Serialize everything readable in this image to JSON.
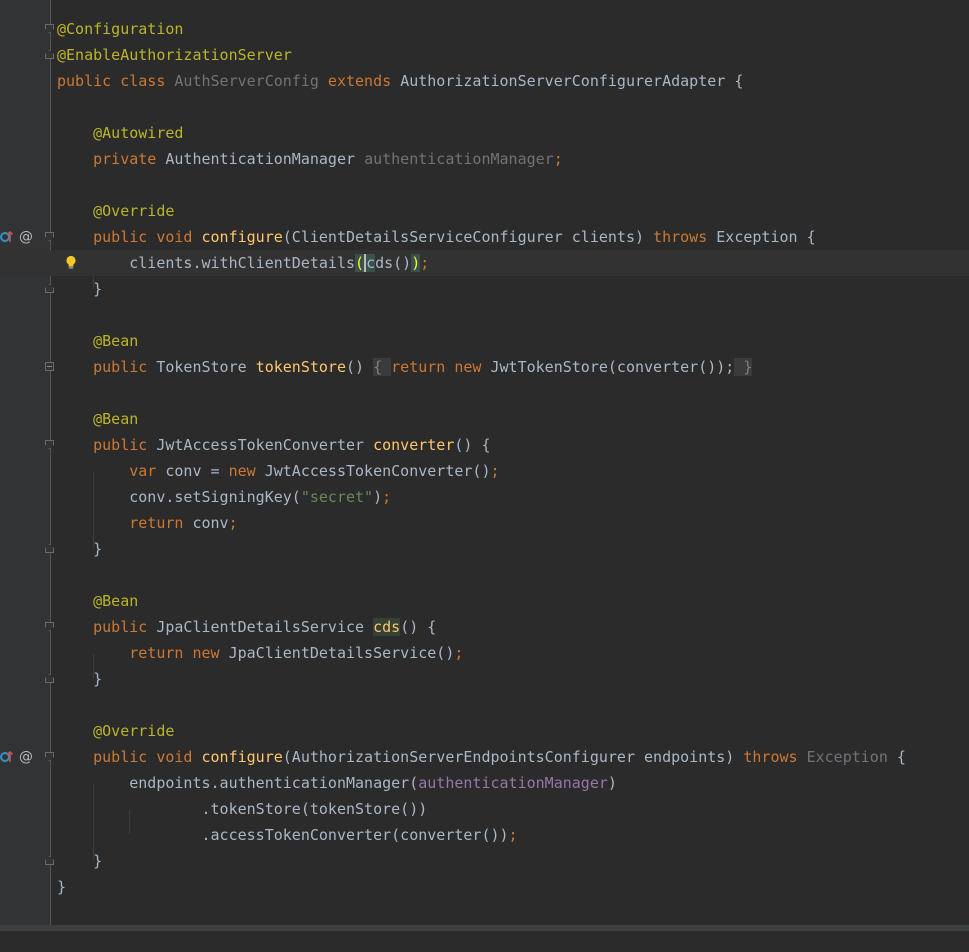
{
  "colors": {
    "background": "#2b2b2b",
    "gutter": "#313335",
    "keyword": "#cc7832",
    "annotation": "#bbb529",
    "method": "#ffc66d",
    "string": "#6a8759",
    "field": "#9876aa",
    "text": "#a9b7c6"
  },
  "code": {
    "l1": "@Configuration",
    "l2": "@EnableAuthorizationServer",
    "l3_public": "public class ",
    "l3_name": "AuthServerConfig",
    "l3_extends": " extends ",
    "l3_super": "AuthorizationServerConfigurerAdapter {",
    "l5": "@Autowired",
    "l6_private": "private ",
    "l6_type": "AuthenticationManager ",
    "l6_field": "authenticationManager",
    "l6_semi": ";",
    "l8": "@Override",
    "l9_kw": "public void ",
    "l9_fn": "configure",
    "l9_params": "(ClientDetailsServiceConfigurer clients) ",
    "l9_throws": "throws ",
    "l9_exc": "Exception {",
    "l10_a": "clients.withClientDetails",
    "l10_open": "(",
    "l10_c": "c",
    "l10_ds": "ds()",
    "l10_close": ")",
    "l10_semi": ";",
    "l11": "}",
    "l13": "@Bean",
    "l14_kw": "public ",
    "l14_type": "TokenStore ",
    "l14_fn": "tokenStore",
    "l14_paren": "() ",
    "l14_ob": "{ ",
    "l14_ret": "return new ",
    "l14_expr": "JwtTokenStore(converter());",
    "l14_cb": " }",
    "l16": "@Bean",
    "l17_kw": "public ",
    "l17_type": "JwtAccessTokenConverter ",
    "l17_fn": "converter",
    "l17_rest": "() {",
    "l18_var": "var ",
    "l18_mid": "conv = ",
    "l18_new": "new ",
    "l18_expr": "JwtAccessTokenConverter()",
    "l18_semi": ";",
    "l19_a": "conv.setSigningKey(",
    "l19_str": "\"secret\"",
    "l19_b": ")",
    "l19_semi": ";",
    "l20_ret": "return ",
    "l20_val": "conv",
    "l20_semi": ";",
    "l21": "}",
    "l23": "@Bean",
    "l24_kw": "public ",
    "l24_type": "JpaClientDetailsService ",
    "l24_fn": "cds",
    "l24_rest": "() {",
    "l25_kw": "return new ",
    "l25_expr": "JpaClientDetailsService()",
    "l25_semi": ";",
    "l26": "}",
    "l28": "@Override",
    "l29_kw": "public void ",
    "l29_fn": "configure",
    "l29_params": "(AuthorizationServerEndpointsConfigurer endpoints) ",
    "l29_throws": "throws ",
    "l29_exc": "Exception",
    "l29_brace": " {",
    "l30_a": "endpoints.authenticationManager(",
    "l30_field": "authenticationManager",
    "l30_b": ")",
    "l31": ".tokenStore(tokenStore())",
    "l32_a": ".accessTokenConverter(converter())",
    "l32_semi": ";",
    "l33": "}",
    "l34": "}"
  },
  "gutter_icons": {
    "override": "override-implements-icon",
    "at": "@",
    "bulb": "lightbulb-icon"
  }
}
